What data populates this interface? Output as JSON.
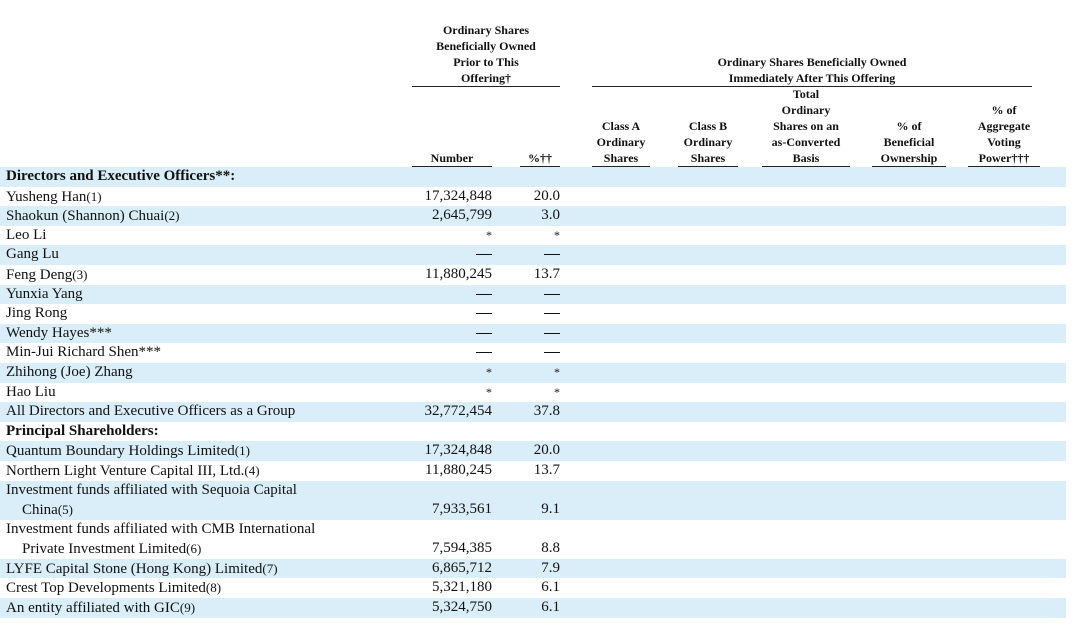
{
  "header": {
    "prior_group": [
      "Ordinary Shares",
      "Beneficially Owned",
      "Prior to This",
      "Offering†"
    ],
    "after_group": [
      "Ordinary Shares Beneficially Owned",
      "Immediately After This Offering"
    ],
    "col_number": "Number",
    "col_pct": "%††",
    "col_class_a": [
      "Class A",
      "Ordinary",
      "Shares"
    ],
    "col_class_b": [
      "Class B",
      "Ordinary",
      "Shares"
    ],
    "col_total": [
      "Total",
      "Ordinary",
      "Shares on an",
      "as-Converted",
      "Basis"
    ],
    "col_beneficial": [
      "% of",
      "Beneficial",
      "Ownership"
    ],
    "col_voting": [
      "% of",
      "Aggregate",
      "Voting",
      "Power†††"
    ]
  },
  "rows": [
    {
      "label": "Directors and Executive Officers**:",
      "bold": true,
      "number": "",
      "pct": "",
      "shade": true
    },
    {
      "label": "Yusheng Han",
      "fn": "(1)",
      "number": "17,324,848",
      "pct": "20.0",
      "shade": false
    },
    {
      "label": "Shaokun (Shannon) Chuai",
      "fn": "(2)",
      "number": "2,645,799",
      "pct": "3.0",
      "shade": true
    },
    {
      "label": "Leo Li",
      "fn": "",
      "number": "*",
      "pct": "*",
      "shade": false
    },
    {
      "label": "Gang Lu",
      "fn": "",
      "number": "—",
      "pct": "—",
      "shade": true
    },
    {
      "label": "Feng Deng",
      "fn": "(3)",
      "number": "11,880,245",
      "pct": "13.7",
      "shade": false
    },
    {
      "label": "Yunxia Yang",
      "fn": "",
      "number": "—",
      "pct": "—",
      "shade": true
    },
    {
      "label": "Jing Rong",
      "fn": "",
      "number": "—",
      "pct": "—",
      "shade": false
    },
    {
      "label": "Wendy Hayes***",
      "fn": "",
      "number": "—",
      "pct": "—",
      "shade": true
    },
    {
      "label": "Min-Jui Richard Shen***",
      "fn": "",
      "number": "—",
      "pct": "—",
      "shade": false
    },
    {
      "label": "Zhihong (Joe) Zhang",
      "fn": "",
      "number": "*",
      "pct": "*",
      "shade": true
    },
    {
      "label": "Hao Liu",
      "fn": "",
      "number": "*",
      "pct": "*",
      "shade": false
    },
    {
      "label": "All Directors and Executive Officers as a Group",
      "fn": "",
      "number": "32,772,454",
      "pct": "37.8",
      "shade": true
    },
    {
      "label": "Principal Shareholders:",
      "bold": true,
      "number": "",
      "pct": "",
      "shade": false
    },
    {
      "label": "Quantum Boundary Holdings Limited",
      "fn": "(1)",
      "number": "17,324,848",
      "pct": "20.0",
      "shade": true
    },
    {
      "label": "Northern Light Venture Capital III, Ltd.",
      "fn": "(4)",
      "number": "11,880,245",
      "pct": "13.7",
      "shade": false
    },
    {
      "label": "Investment funds affiliated with Sequoia Capital",
      "label2": "China",
      "fn": "(5)",
      "number": "7,933,561",
      "pct": "9.1",
      "shade": true,
      "double": true
    },
    {
      "label": "Investment funds affiliated with CMB International",
      "label2": "Private Investment Limited",
      "fn": "(6)",
      "number": "7,594,385",
      "pct": "8.8",
      "shade": false,
      "double": true
    },
    {
      "label": "LYFE Capital Stone (Hong Kong) Limited",
      "fn": "(7)",
      "number": "6,865,712",
      "pct": "7.9",
      "shade": true
    },
    {
      "label": "Crest Top Developments Limited",
      "fn": "(8)",
      "number": "5,321,180",
      "pct": "6.1",
      "shade": false
    },
    {
      "label": "An entity affiliated with GIC",
      "fn": "(9)",
      "number": "5,324,750",
      "pct": "6.1",
      "shade": true
    }
  ]
}
